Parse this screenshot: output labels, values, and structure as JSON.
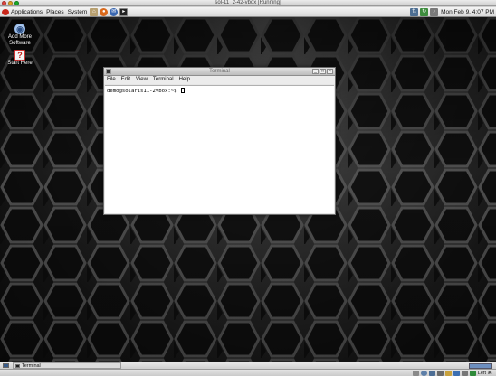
{
  "host_window": {
    "title": "sol-11_2-42-vbox [Running]"
  },
  "top_panel": {
    "applications_label": "Applications",
    "places_label": "Places",
    "system_label": "System",
    "clock": "Mon Feb  9,  4:07 PM"
  },
  "desktop_icons": [
    {
      "label": "Add More Software",
      "icon": "add-software-icon"
    },
    {
      "label": "Start Here",
      "icon": "help-icon"
    }
  ],
  "terminal": {
    "title": "Terminal",
    "menu": [
      "File",
      "Edit",
      "View",
      "Terminal",
      "Help"
    ],
    "prompt": "demo@solaris11-2vbox:~$ "
  },
  "bottom_panel": {
    "taskbar_label": "Terminal"
  },
  "vbox_statusbar": {
    "host_key_label": "Left ⌘"
  },
  "colors": {
    "mac_close": "#e0443e",
    "mac_min": "#dea123",
    "mac_max": "#1aab29",
    "terminal_background": "#ffffff"
  }
}
